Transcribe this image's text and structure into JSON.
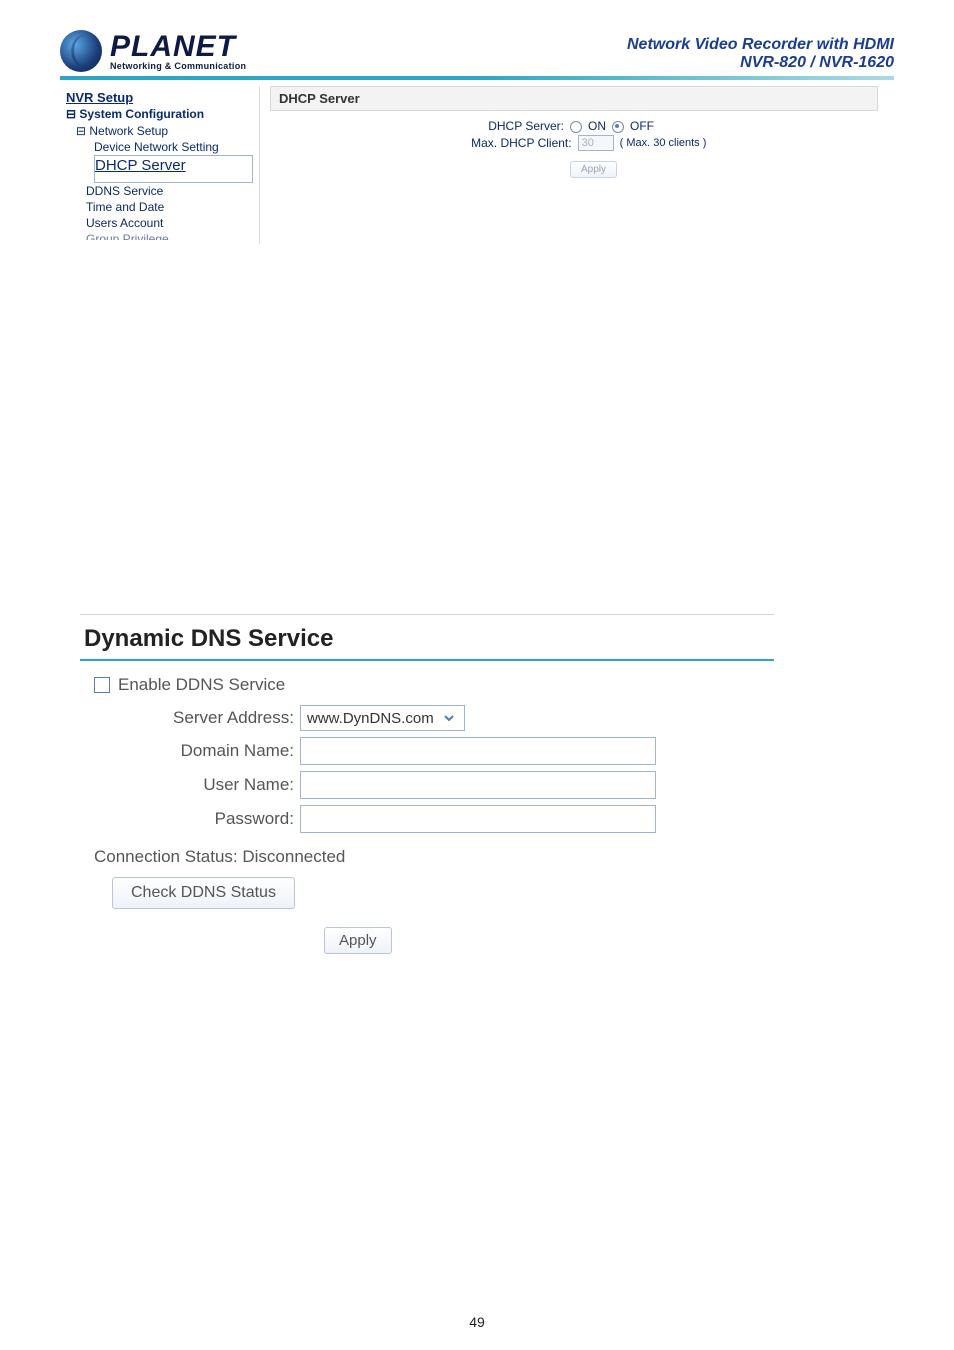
{
  "header": {
    "brand": "PLANET",
    "tagline": "Networking & Communication",
    "title_line1": "Network Video Recorder with HDMI",
    "title_line2": "NVR-820 / NVR-1620"
  },
  "panel1": {
    "nav": {
      "title": "NVR Setup",
      "section": "System Configuration",
      "items": {
        "network_setup": "Network Setup",
        "device_network_setting": "Device Network Setting",
        "dhcp_server": "DHCP Server",
        "ddns_service": "DDNS Service",
        "time_and_date": "Time and Date",
        "users_account": "Users Account",
        "group_privilege_truncated": "Group Privilege"
      }
    },
    "content": {
      "panel_title": "DHCP Server",
      "row_server_label": "DHCP Server:",
      "on_label": "ON",
      "off_label": "OFF",
      "server_state": "OFF",
      "row_max_label": "Max. DHCP Client:",
      "max_value": "30",
      "max_hint": "( Max. 30 clients )",
      "apply_label": "Apply"
    }
  },
  "panel2": {
    "title": "Dynamic DNS Service",
    "enable_label": "Enable DDNS Service",
    "enable_checked": false,
    "rows": {
      "server_address_label": "Server Address:",
      "server_address_value": "www.DynDNS.com",
      "domain_name_label": "Domain Name:",
      "domain_name_value": "",
      "user_name_label": "User Name:",
      "user_name_value": "",
      "password_label": "Password:",
      "password_value": ""
    },
    "connection_status_label": "Connection Status: Disconnected",
    "check_btn_label": "Check DDNS Status",
    "apply_label": "Apply"
  },
  "footer": {
    "page_number": "49"
  }
}
